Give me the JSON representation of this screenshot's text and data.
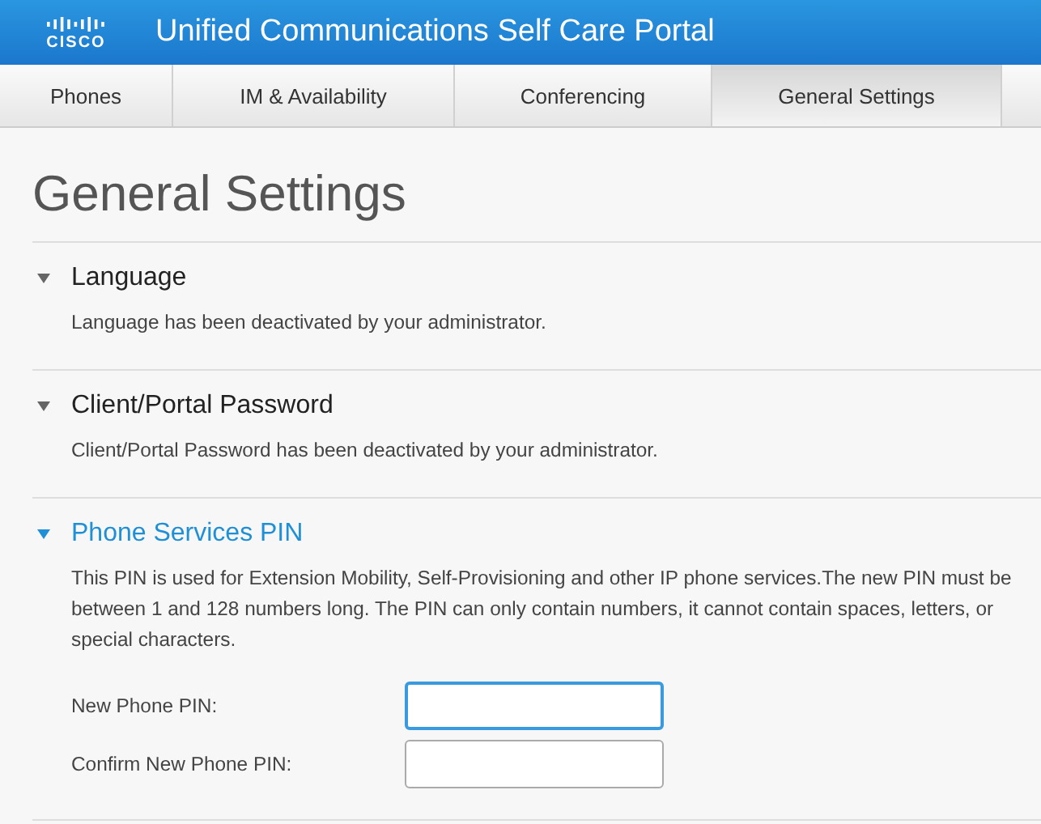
{
  "header": {
    "logo": "CISCO",
    "title": "Unified Communications Self Care Portal"
  },
  "tabs": [
    {
      "label": "Phones",
      "selected": false
    },
    {
      "label": "IM & Availability",
      "selected": false
    },
    {
      "label": "Conferencing",
      "selected": false
    },
    {
      "label": "General Settings",
      "selected": true
    }
  ],
  "page_title": "General Settings",
  "sections": [
    {
      "title": "Language",
      "expanded": true,
      "active": false,
      "text": "Language has been deactivated by your administrator."
    },
    {
      "title": "Client/Portal Password",
      "expanded": true,
      "active": false,
      "text": "Client/Portal Password has been deactivated by your administrator."
    },
    {
      "title": "Phone Services PIN",
      "expanded": true,
      "active": true,
      "text": "This PIN is used for Extension Mobility, Self-Provisioning and other IP phone services.The new PIN must be between 1 and 128 numbers long. The PIN can only contain numbers, it cannot contain spaces, letters, or special characters.",
      "fields": [
        {
          "label": "New Phone PIN:",
          "focused": true
        },
        {
          "label": "Confirm New Phone PIN:",
          "focused": false
        }
      ]
    }
  ]
}
